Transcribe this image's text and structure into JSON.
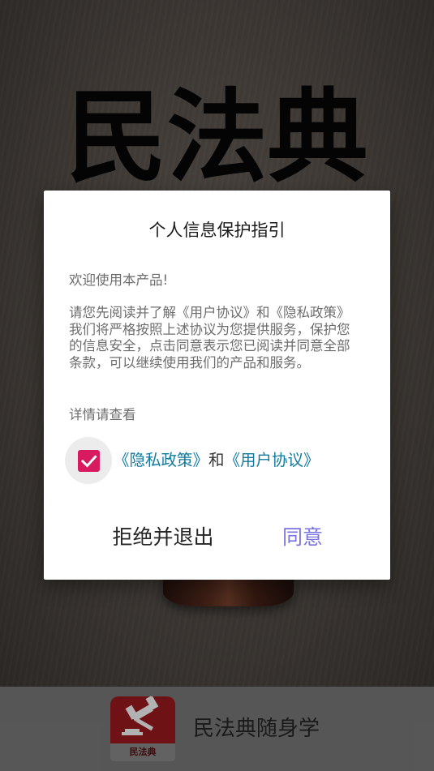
{
  "background": {
    "title": "民法典"
  },
  "dialog": {
    "title": "个人信息保护指引",
    "welcome": "欢迎使用本产品!",
    "body": "请您先阅读并了解《用户协议》和《隐私政策》我们将严格按照上述协议为您提供服务，保护您的信息安全，点击同意表示您已阅读并同意全部条款，可以继续使用我们的产品和服务。",
    "details_label": "详情请查看",
    "consent": {
      "checked": true,
      "privacy_link": "《隐私政策》",
      "conjunction": "和",
      "terms_link": "《用户协议》"
    },
    "reject_button": "拒绝并退出",
    "agree_button": "同意"
  },
  "bottom_bar": {
    "logo_text": "民法典",
    "app_name": "民法典随身学",
    "logo_icon": "gavel-icon"
  },
  "colors": {
    "checkbox": "#d81b60",
    "link": "#117a9e",
    "agree": "#7a73e0",
    "logo": "#9e1a1f"
  }
}
